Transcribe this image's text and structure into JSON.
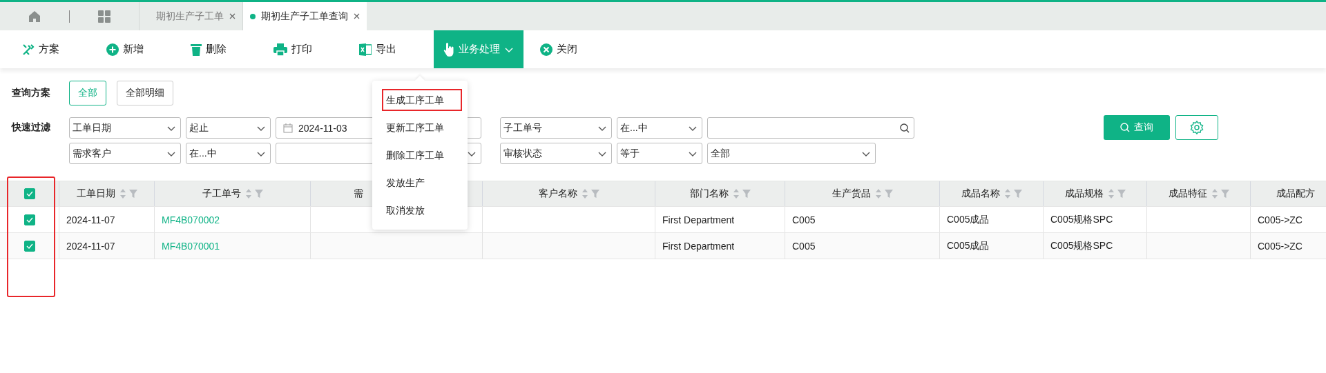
{
  "tab_bar": {
    "tabs": [
      {
        "label": "期初生产子工单",
        "selected": false
      },
      {
        "label": "期初生产子工单查询",
        "selected": true
      }
    ]
  },
  "toolbar": {
    "buttons": [
      {
        "label": "方案",
        "expanded": false
      },
      {
        "label": "新增",
        "expanded": false
      },
      {
        "label": "删除",
        "expanded": false
      },
      {
        "label": "打印",
        "expanded": false
      },
      {
        "label": "导出",
        "expanded": false
      },
      {
        "label": "业务处理",
        "expanded": true
      },
      {
        "label": "关闭",
        "expanded": false
      }
    ]
  },
  "action_menu": {
    "items": [
      {
        "label": "生成工序工单",
        "highlighted": true
      },
      {
        "label": "更新工序工单",
        "highlighted": false
      },
      {
        "label": "删除工序工单",
        "highlighted": false
      },
      {
        "label": "发放生产",
        "highlighted": false
      },
      {
        "label": "取消发放",
        "highlighted": false
      }
    ]
  },
  "query_scheme": {
    "label": "查询方案",
    "options": [
      {
        "label": "全部",
        "selected": true
      },
      {
        "label": "全部明细",
        "selected": false
      }
    ]
  },
  "quick_filter": {
    "label": "快速过滤",
    "rows": [
      [
        {
          "field": "工单日期",
          "operator": "起止",
          "kind": "date",
          "value": "2024-11-03"
        },
        {
          "field": "子工单号",
          "operator": "在...中",
          "kind": "search"
        }
      ],
      [
        {
          "field": "需求客户",
          "operator": "在...中",
          "kind": "select"
        },
        {
          "field": "审核状态",
          "operator": "等于",
          "kind": "select",
          "value": "全部"
        }
      ]
    ],
    "query_button": "查询"
  },
  "table": {
    "all_checked": true,
    "checkbox_column_highlighted": true,
    "columns": [
      {
        "label": "工单日期",
        "sort_filter": true,
        "kind": "text"
      },
      {
        "label": "子工单号",
        "sort_filter": true,
        "kind": "link"
      },
      {
        "label": "需",
        "sort_filter": false,
        "kind": "text"
      },
      {
        "label": "客户名称",
        "sort_filter": true,
        "kind": "text"
      },
      {
        "label": "部门名称",
        "sort_filter": true,
        "kind": "text"
      },
      {
        "label": "生产货品",
        "sort_filter": true,
        "kind": "text"
      },
      {
        "label": "成品名称",
        "sort_filter": true,
        "kind": "text"
      },
      {
        "label": "成品规格",
        "sort_filter": true,
        "kind": "text"
      },
      {
        "label": "成品特征",
        "sort_filter": true,
        "kind": "text"
      },
      {
        "label": "成品配方",
        "sort_filter": false,
        "kind": "text"
      }
    ],
    "rows": [
      {
        "selected": true,
        "cells": [
          "2024-11-07",
          "MF4B070002",
          "",
          "",
          "First Department",
          "C005",
          "C005成品",
          "C005规格SPC",
          "",
          "C005->ZC"
        ]
      },
      {
        "selected": true,
        "cells": [
          "2024-11-07",
          "MF4B070001",
          "",
          "",
          "First Department",
          "C005",
          "C005成品",
          "C005规格SPC",
          "",
          "C005->ZC"
        ]
      }
    ]
  }
}
